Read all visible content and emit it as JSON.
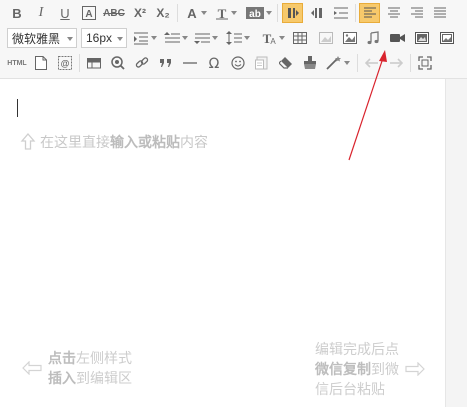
{
  "toolbar": {
    "row1": {
      "bold": "B",
      "italic": "I",
      "underline": "U",
      "strike": "ABC",
      "superscript": "X²",
      "subscript": "X₂"
    },
    "row2": {
      "font_family": "微软雅黑",
      "font_size": "16px"
    },
    "row3": {
      "html": "HTML"
    }
  },
  "content": {
    "placeholder_pre": "在这里直接",
    "placeholder_bold": "输入或粘贴",
    "placeholder_post": "内容",
    "left_hint": {
      "line1_bold": "点击",
      "line1_rest": "左侧样式",
      "line2_bold": "插入",
      "line2_rest": "到编辑区"
    },
    "right_hint": {
      "line1": "编辑完成后点",
      "line2_bold": "微信复制",
      "line2_rest": "到微",
      "line3": "信后台粘贴"
    }
  },
  "colors": {
    "active_bg": "#f7c96b",
    "annotation_arrow": "#d9232d"
  },
  "icons": [
    "bold",
    "italic",
    "underline",
    "box-text",
    "strikethrough",
    "superscript",
    "subscript",
    "font-color",
    "text-highlight",
    "bg-color",
    "ltr",
    "rtl",
    "indent",
    "align-left",
    "align-center",
    "align-right",
    "justify",
    "font-family",
    "font-size",
    "row-spacing",
    "line-height",
    "paragraph-spacing",
    "paragraph-format",
    "table",
    "image",
    "insert-image",
    "music",
    "video",
    "gallery",
    "html",
    "document",
    "code",
    "horizontal-table",
    "anchor",
    "link",
    "quote",
    "horizontal-rule",
    "omega",
    "emotion",
    "template",
    "eraser",
    "format-brush",
    "magic-wand",
    "undo",
    "redo",
    "fullscreen"
  ]
}
